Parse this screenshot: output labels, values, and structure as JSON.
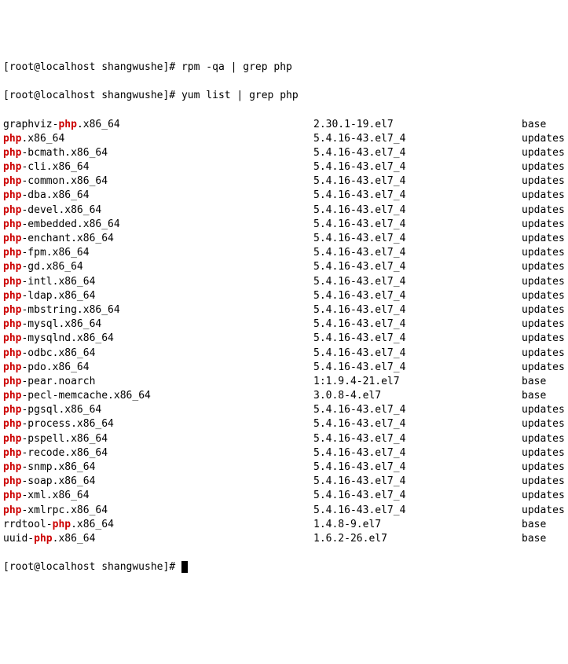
{
  "prompt": "[root@localhost shangwushe]#",
  "cmd1": "rpm -qa | grep php",
  "cmd2": "yum list | grep php",
  "packages": [
    {
      "prefix": "graphviz-",
      "match": "php",
      "suffix": ".x86_64",
      "version": "2.30.1-19.el7",
      "repo": "base"
    },
    {
      "prefix": "",
      "match": "php",
      "suffix": ".x86_64",
      "version": "5.4.16-43.el7_4",
      "repo": "updates"
    },
    {
      "prefix": "",
      "match": "php",
      "suffix": "-bcmath.x86_64",
      "version": "5.4.16-43.el7_4",
      "repo": "updates"
    },
    {
      "prefix": "",
      "match": "php",
      "suffix": "-cli.x86_64",
      "version": "5.4.16-43.el7_4",
      "repo": "updates"
    },
    {
      "prefix": "",
      "match": "php",
      "suffix": "-common.x86_64",
      "version": "5.4.16-43.el7_4",
      "repo": "updates"
    },
    {
      "prefix": "",
      "match": "php",
      "suffix": "-dba.x86_64",
      "version": "5.4.16-43.el7_4",
      "repo": "updates"
    },
    {
      "prefix": "",
      "match": "php",
      "suffix": "-devel.x86_64",
      "version": "5.4.16-43.el7_4",
      "repo": "updates"
    },
    {
      "prefix": "",
      "match": "php",
      "suffix": "-embedded.x86_64",
      "version": "5.4.16-43.el7_4",
      "repo": "updates"
    },
    {
      "prefix": "",
      "match": "php",
      "suffix": "-enchant.x86_64",
      "version": "5.4.16-43.el7_4",
      "repo": "updates"
    },
    {
      "prefix": "",
      "match": "php",
      "suffix": "-fpm.x86_64",
      "version": "5.4.16-43.el7_4",
      "repo": "updates"
    },
    {
      "prefix": "",
      "match": "php",
      "suffix": "-gd.x86_64",
      "version": "5.4.16-43.el7_4",
      "repo": "updates"
    },
    {
      "prefix": "",
      "match": "php",
      "suffix": "-intl.x86_64",
      "version": "5.4.16-43.el7_4",
      "repo": "updates"
    },
    {
      "prefix": "",
      "match": "php",
      "suffix": "-ldap.x86_64",
      "version": "5.4.16-43.el7_4",
      "repo": "updates"
    },
    {
      "prefix": "",
      "match": "php",
      "suffix": "-mbstring.x86_64",
      "version": "5.4.16-43.el7_4",
      "repo": "updates"
    },
    {
      "prefix": "",
      "match": "php",
      "suffix": "-mysql.x86_64",
      "version": "5.4.16-43.el7_4",
      "repo": "updates"
    },
    {
      "prefix": "",
      "match": "php",
      "suffix": "-mysqlnd.x86_64",
      "version": "5.4.16-43.el7_4",
      "repo": "updates"
    },
    {
      "prefix": "",
      "match": "php",
      "suffix": "-odbc.x86_64",
      "version": "5.4.16-43.el7_4",
      "repo": "updates"
    },
    {
      "prefix": "",
      "match": "php",
      "suffix": "-pdo.x86_64",
      "version": "5.4.16-43.el7_4",
      "repo": "updates"
    },
    {
      "prefix": "",
      "match": "php",
      "suffix": "-pear.noarch",
      "version": "1:1.9.4-21.el7",
      "repo": "base"
    },
    {
      "prefix": "",
      "match": "php",
      "suffix": "-pecl-memcache.x86_64",
      "version": "3.0.8-4.el7",
      "repo": "base"
    },
    {
      "prefix": "",
      "match": "php",
      "suffix": "-pgsql.x86_64",
      "version": "5.4.16-43.el7_4",
      "repo": "updates"
    },
    {
      "prefix": "",
      "match": "php",
      "suffix": "-process.x86_64",
      "version": "5.4.16-43.el7_4",
      "repo": "updates"
    },
    {
      "prefix": "",
      "match": "php",
      "suffix": "-pspell.x86_64",
      "version": "5.4.16-43.el7_4",
      "repo": "updates"
    },
    {
      "prefix": "",
      "match": "php",
      "suffix": "-recode.x86_64",
      "version": "5.4.16-43.el7_4",
      "repo": "updates"
    },
    {
      "prefix": "",
      "match": "php",
      "suffix": "-snmp.x86_64",
      "version": "5.4.16-43.el7_4",
      "repo": "updates"
    },
    {
      "prefix": "",
      "match": "php",
      "suffix": "-soap.x86_64",
      "version": "5.4.16-43.el7_4",
      "repo": "updates"
    },
    {
      "prefix": "",
      "match": "php",
      "suffix": "-xml.x86_64",
      "version": "5.4.16-43.el7_4",
      "repo": "updates"
    },
    {
      "prefix": "",
      "match": "php",
      "suffix": "-xmlrpc.x86_64",
      "version": "5.4.16-43.el7_4",
      "repo": "updates"
    },
    {
      "prefix": "rrdtool-",
      "match": "php",
      "suffix": ".x86_64",
      "version": "1.4.8-9.el7",
      "repo": "base"
    },
    {
      "prefix": "uuid-",
      "match": "php",
      "suffix": ".x86_64",
      "version": "1.6.2-26.el7",
      "repo": "base"
    }
  ]
}
